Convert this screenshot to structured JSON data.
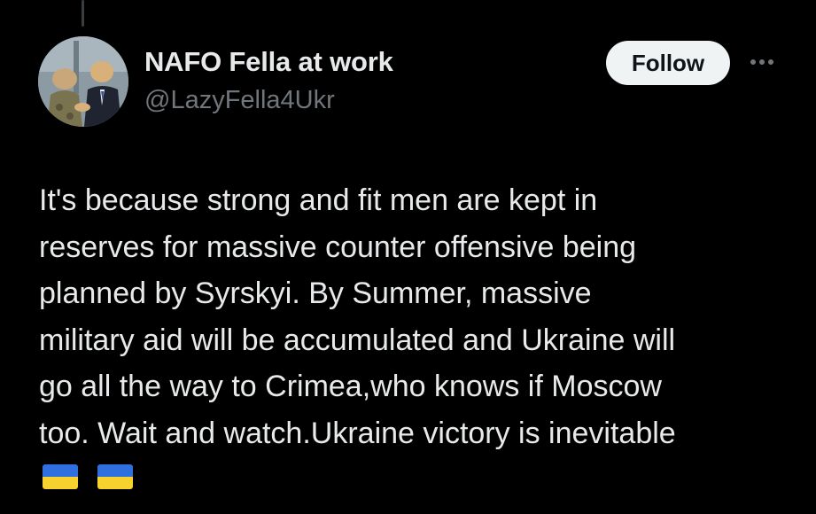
{
  "author": {
    "display_name": "NAFO Fella at work",
    "handle": "@LazyFella4Ukr",
    "avatar_icon": "profile-avatar"
  },
  "actions": {
    "follow_label": "Follow",
    "more_icon": "more-horizontal-icon"
  },
  "tweet": {
    "lines": [
      "It's because strong and fit men are kept in",
      "reserves for massive counter offensive being",
      "planned by Syrskyi. By Summer, massive",
      "military aid will be accumulated and Ukraine will",
      "go all the way to Crimea,who knows if Moscow",
      "too. Wait and watch.Ukraine victory is inevitable"
    ],
    "emoji": [
      "🇺🇦",
      "🇺🇦"
    ]
  },
  "colors": {
    "background": "#000000",
    "primary_text": "#e7e9ea",
    "secondary_text": "#71767b",
    "follow_bg": "#eff3f4",
    "follow_text": "#0f1419",
    "flag_blue": "#2f6fe0",
    "flag_yellow": "#f7d12e"
  }
}
